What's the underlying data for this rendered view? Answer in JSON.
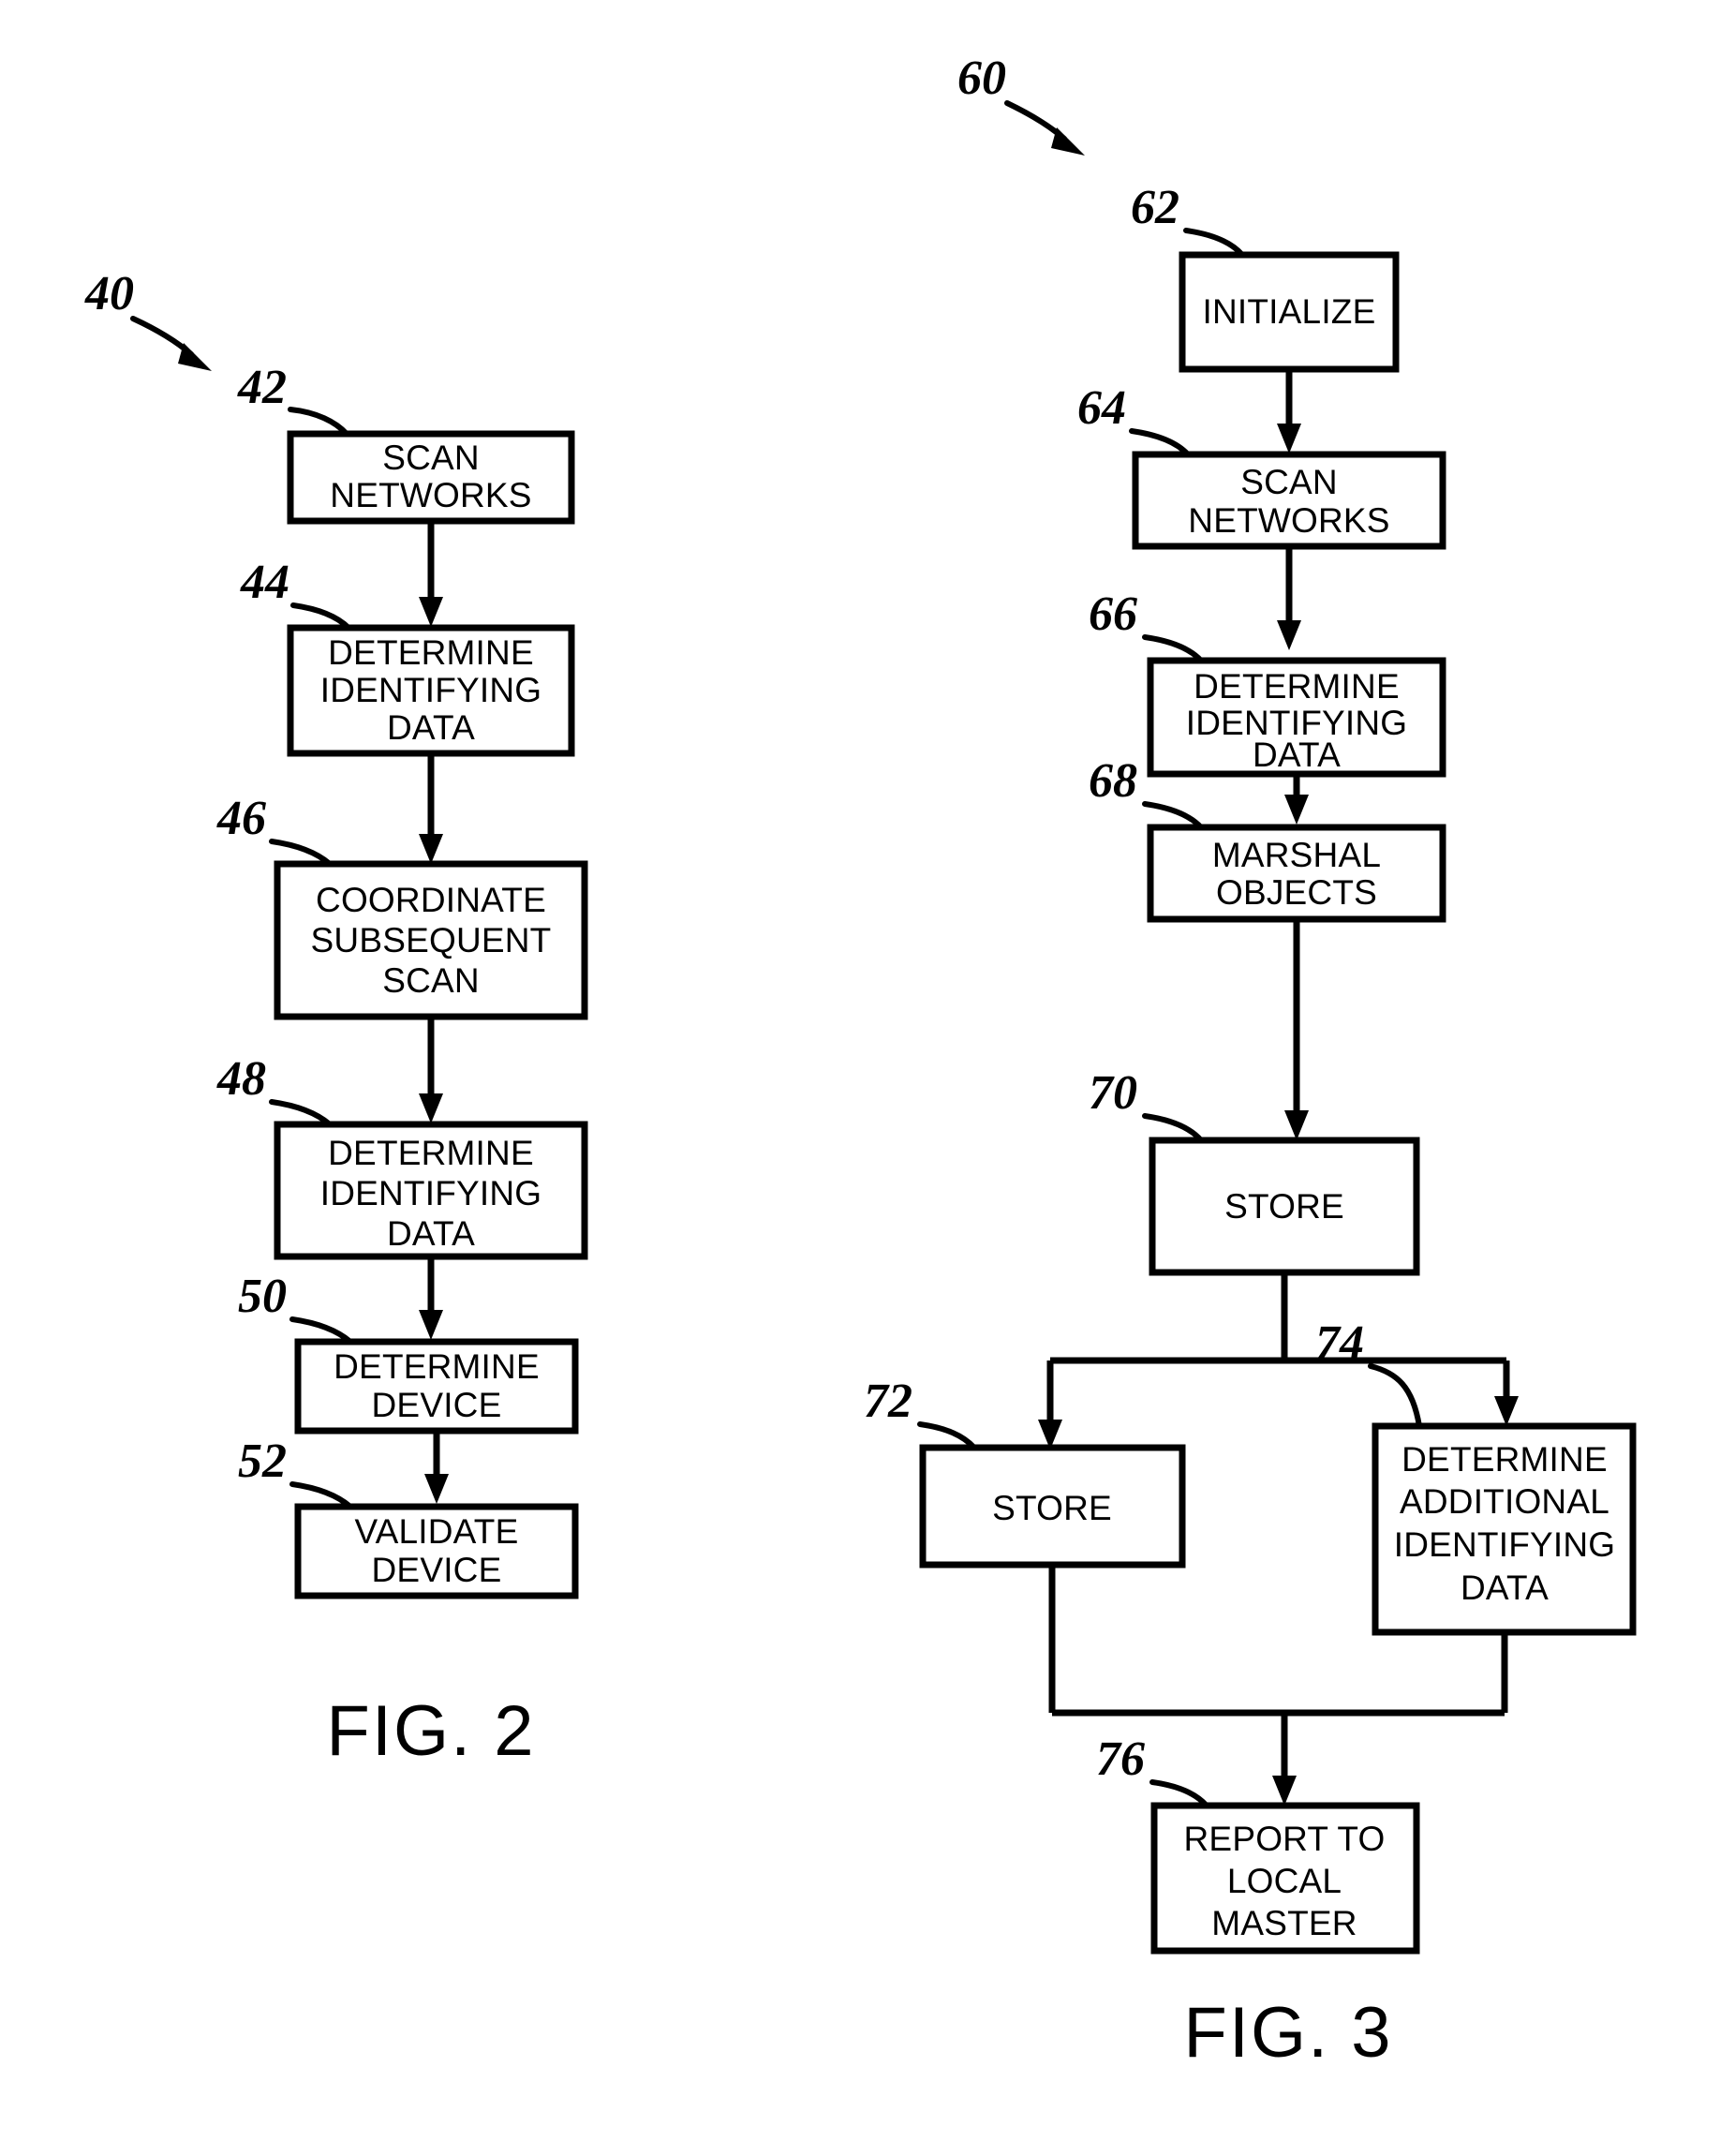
{
  "document": {
    "type": "patent-drawing-sheet",
    "figures": [
      {
        "id": "fig2",
        "caption": "FIG. 2",
        "flow_ref": "40",
        "nodes": [
          {
            "ref": "42",
            "label_lines": [
              "SCAN",
              "NETWORKS"
            ]
          },
          {
            "ref": "44",
            "label_lines": [
              "DETERMINE",
              "IDENTIFYING",
              "DATA"
            ]
          },
          {
            "ref": "46",
            "label_lines": [
              "COORDINATE",
              "SUBSEQUENT",
              "SCAN"
            ]
          },
          {
            "ref": "48",
            "label_lines": [
              "DETERMINE",
              "IDENTIFYING",
              "DATA"
            ]
          },
          {
            "ref": "50",
            "label_lines": [
              "DETERMINE",
              "DEVICE"
            ]
          },
          {
            "ref": "52",
            "label_lines": [
              "VALIDATE",
              "DEVICE"
            ]
          }
        ]
      },
      {
        "id": "fig3",
        "caption": "FIG. 3",
        "flow_ref": "60",
        "nodes": [
          {
            "ref": "62",
            "label_lines": [
              "INITIALIZE"
            ]
          },
          {
            "ref": "64",
            "label_lines": [
              "SCAN",
              "NETWORKS"
            ]
          },
          {
            "ref": "66",
            "label_lines": [
              "DETERMINE",
              "IDENTIFYING",
              "DATA"
            ]
          },
          {
            "ref": "68",
            "label_lines": [
              "MARSHAL",
              "OBJECTS"
            ]
          },
          {
            "ref": "70",
            "label_lines": [
              "STORE"
            ]
          },
          {
            "ref": "72",
            "label_lines": [
              "STORE"
            ]
          },
          {
            "ref": "74",
            "label_lines": [
              "DETERMINE",
              "ADDITIONAL",
              "IDENTIFYING",
              "DATA"
            ]
          },
          {
            "ref": "76",
            "label_lines": [
              "REPORT TO",
              "LOCAL",
              "MASTER"
            ]
          }
        ]
      }
    ],
    "colors": {
      "ink": "#000000",
      "paper": "#ffffff"
    }
  }
}
